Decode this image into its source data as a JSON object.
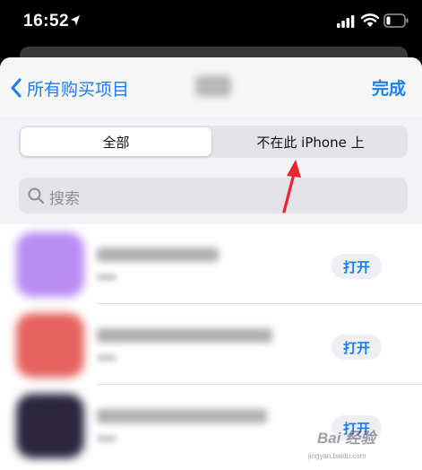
{
  "status_bar": {
    "time": "16:52"
  },
  "navbar": {
    "back_label": "所有购买项目",
    "done_label": "完成"
  },
  "segmented_control": {
    "segments": [
      "全部",
      "不在此 iPhone 上"
    ],
    "selected": "全部"
  },
  "search": {
    "placeholder": "搜索"
  },
  "apps": [
    {
      "icon_color": "#b98cf2",
      "action_label": "打开"
    },
    {
      "icon_color": "#e5625d",
      "action_label": "打开"
    },
    {
      "icon_color": "#2b2540",
      "action_label": "打开"
    }
  ],
  "annotation": {
    "arrow_color": "#e8262b"
  },
  "watermark": {
    "logo": "Bai 经验",
    "url": "jingyan.baidu.com"
  },
  "colors": {
    "accent": "#1a7cf2",
    "sheet_background": "#f2f2f7"
  }
}
